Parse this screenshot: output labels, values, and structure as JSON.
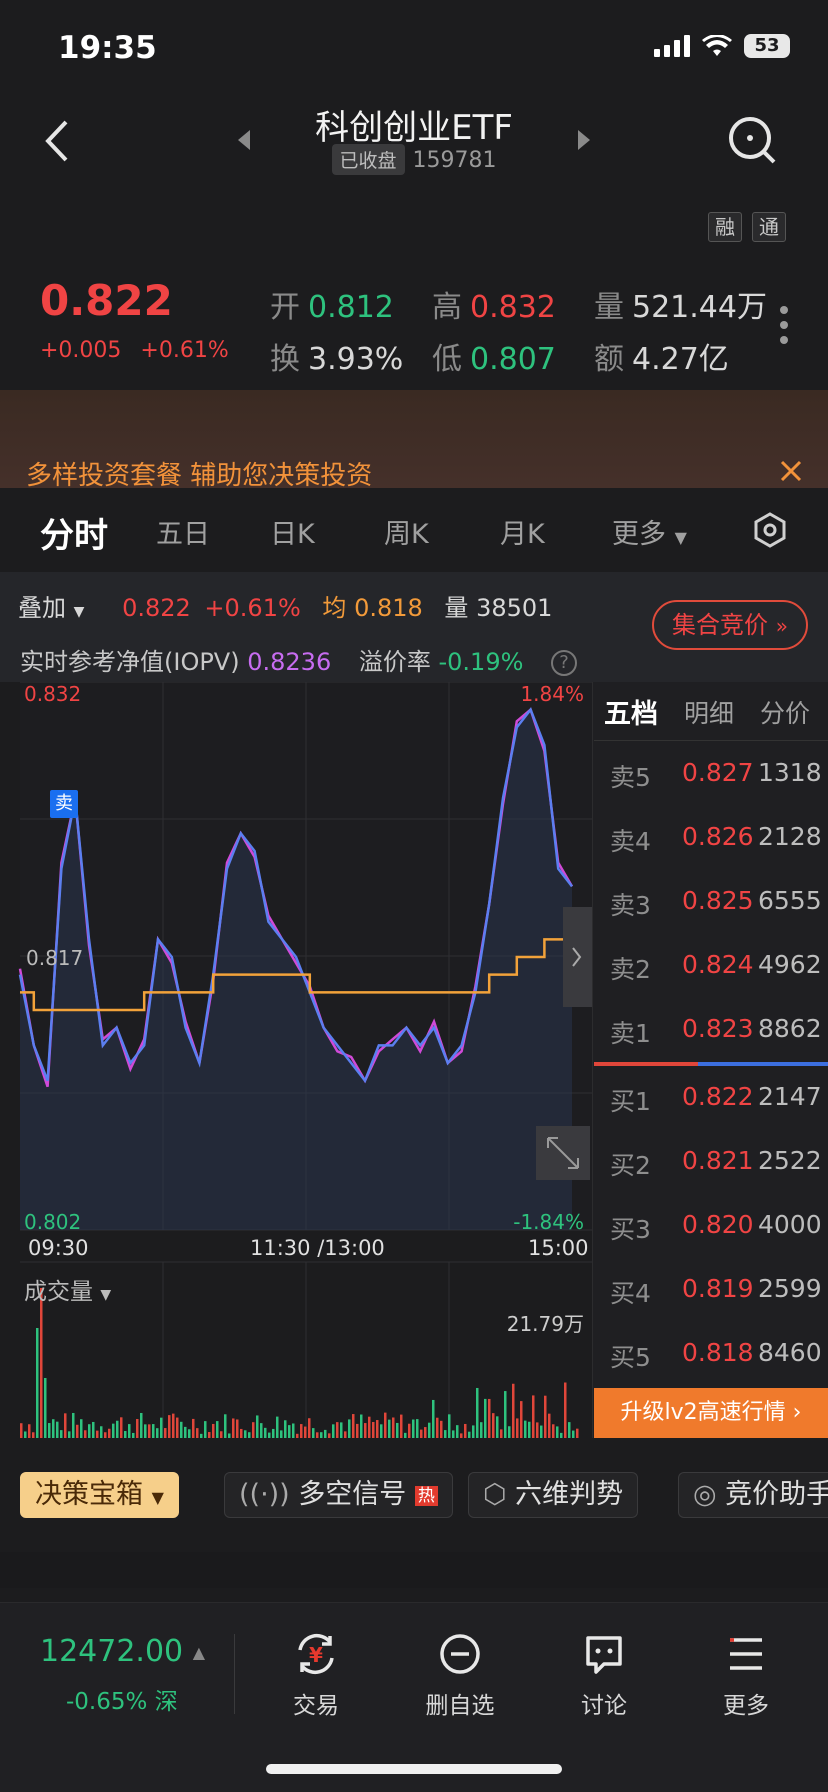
{
  "status": {
    "time": "19:35",
    "battery": "53"
  },
  "header": {
    "title": "科创创业ETF",
    "closed": "已收盘",
    "code": "159781",
    "tag_rong": "融",
    "tag_tong": "通"
  },
  "quote": {
    "price": "0.822",
    "change": "+0.005",
    "change_pct": "+0.61%",
    "open_label": "开",
    "open": "0.812",
    "high_label": "高",
    "high": "0.832",
    "vol_label": "量",
    "vol": "521.44万",
    "turnover_label": "换",
    "turnover": "3.93%",
    "low_label": "低",
    "low": "0.807",
    "amount_label": "额",
    "amount": "4.27亿"
  },
  "banner": {
    "text": "多样投资套餐 辅助您决策投资"
  },
  "tabs": [
    "分时",
    "五日",
    "日K",
    "周K",
    "月K",
    "更多"
  ],
  "chart_header": {
    "overlay": "叠加",
    "price": "0.822",
    "pct": "+0.61%",
    "avg_label": "均",
    "avg": "0.818",
    "vol_label": "量",
    "vol": "38501",
    "auction_btn": "集合竞价",
    "iopv_label": "实时参考净值(IOPV)",
    "iopv": "0.8236",
    "premium_label": "溢价率",
    "premium": "-0.19%"
  },
  "chart": {
    "max": "0.832",
    "max_pct": "1.84%",
    "mid": "0.817",
    "min": "0.802",
    "min_pct": "-1.84%",
    "sell_marker": "卖",
    "t_start": "09:30",
    "t_mid": "11:30 /13:00",
    "t_end": "15:00",
    "vol_title": "成交量",
    "vol_max": "21.79万"
  },
  "chart_data": {
    "type": "line",
    "ylim": [
      0.802,
      0.832
    ],
    "series": [
      {
        "values": [
          0.816,
          0.812,
          0.81,
          0.822,
          0.826,
          0.818,
          0.812,
          0.813,
          0.811,
          0.812,
          0.818,
          0.817,
          0.813,
          0.811,
          0.816,
          0.822,
          0.824,
          0.823,
          0.819,
          0.818,
          0.817,
          0.815,
          0.813,
          0.812,
          0.811,
          0.81,
          0.812,
          0.812,
          0.813,
          0.812,
          0.813,
          0.811,
          0.812,
          0.815,
          0.82,
          0.826,
          0.83,
          0.831,
          0.829,
          0.822,
          0.821
        ]
      },
      {
        "values": [
          0.815,
          0.814,
          0.814,
          0.814,
          0.814,
          0.814,
          0.814,
          0.814,
          0.814,
          0.815,
          0.815,
          0.815,
          0.815,
          0.815,
          0.816,
          0.816,
          0.816,
          0.816,
          0.816,
          0.816,
          0.816,
          0.815,
          0.815,
          0.815,
          0.815,
          0.815,
          0.815,
          0.815,
          0.815,
          0.815,
          0.815,
          0.815,
          0.815,
          0.815,
          0.816,
          0.816,
          0.817,
          0.817,
          0.818,
          0.818,
          0.818
        ]
      }
    ]
  },
  "book": {
    "tab_five": "五档",
    "tab_detail": "明细",
    "tab_dist": "分价",
    "sells": [
      {
        "l": "卖5",
        "p": "0.827",
        "v": "1318"
      },
      {
        "l": "卖4",
        "p": "0.826",
        "v": "2128"
      },
      {
        "l": "卖3",
        "p": "0.825",
        "v": "6555"
      },
      {
        "l": "卖2",
        "p": "0.824",
        "v": "4962"
      },
      {
        "l": "卖1",
        "p": "0.823",
        "v": "8862"
      }
    ],
    "buys": [
      {
        "l": "买1",
        "p": "0.822",
        "v": "2147"
      },
      {
        "l": "买2",
        "p": "0.821",
        "v": "2522"
      },
      {
        "l": "买3",
        "p": "0.820",
        "v": "4000"
      },
      {
        "l": "买4",
        "p": "0.819",
        "v": "2599"
      },
      {
        "l": "买5",
        "p": "0.818",
        "v": "8460"
      }
    ],
    "upgrade": "升级lv2高速行情"
  },
  "tools": {
    "decision": "决策宝箱",
    "signal": "多空信号",
    "hot": "热",
    "six": "六维判势",
    "auction": "竞价助手"
  },
  "index": {
    "value": "12472.00",
    "pct": "-0.65%",
    "market": "深"
  },
  "nav": {
    "trade": "交易",
    "remove": "删自选",
    "discuss": "讨论",
    "more": "更多"
  }
}
